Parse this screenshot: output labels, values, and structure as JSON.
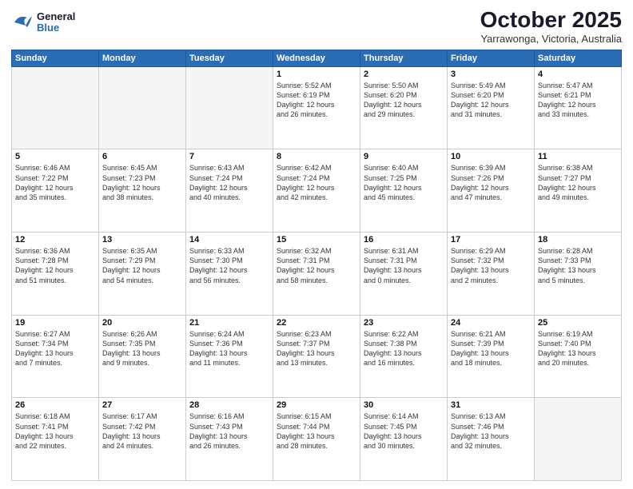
{
  "header": {
    "logo_general": "General",
    "logo_blue": "Blue",
    "title": "October 2025",
    "subtitle": "Yarrawonga, Victoria, Australia"
  },
  "weekdays": [
    "Sunday",
    "Monday",
    "Tuesday",
    "Wednesday",
    "Thursday",
    "Friday",
    "Saturday"
  ],
  "weeks": [
    [
      {
        "day": "",
        "info": ""
      },
      {
        "day": "",
        "info": ""
      },
      {
        "day": "",
        "info": ""
      },
      {
        "day": "1",
        "info": "Sunrise: 5:52 AM\nSunset: 6:19 PM\nDaylight: 12 hours\nand 26 minutes."
      },
      {
        "day": "2",
        "info": "Sunrise: 5:50 AM\nSunset: 6:20 PM\nDaylight: 12 hours\nand 29 minutes."
      },
      {
        "day": "3",
        "info": "Sunrise: 5:49 AM\nSunset: 6:20 PM\nDaylight: 12 hours\nand 31 minutes."
      },
      {
        "day": "4",
        "info": "Sunrise: 5:47 AM\nSunset: 6:21 PM\nDaylight: 12 hours\nand 33 minutes."
      }
    ],
    [
      {
        "day": "5",
        "info": "Sunrise: 6:46 AM\nSunset: 7:22 PM\nDaylight: 12 hours\nand 35 minutes."
      },
      {
        "day": "6",
        "info": "Sunrise: 6:45 AM\nSunset: 7:23 PM\nDaylight: 12 hours\nand 38 minutes."
      },
      {
        "day": "7",
        "info": "Sunrise: 6:43 AM\nSunset: 7:24 PM\nDaylight: 12 hours\nand 40 minutes."
      },
      {
        "day": "8",
        "info": "Sunrise: 6:42 AM\nSunset: 7:24 PM\nDaylight: 12 hours\nand 42 minutes."
      },
      {
        "day": "9",
        "info": "Sunrise: 6:40 AM\nSunset: 7:25 PM\nDaylight: 12 hours\nand 45 minutes."
      },
      {
        "day": "10",
        "info": "Sunrise: 6:39 AM\nSunset: 7:26 PM\nDaylight: 12 hours\nand 47 minutes."
      },
      {
        "day": "11",
        "info": "Sunrise: 6:38 AM\nSunset: 7:27 PM\nDaylight: 12 hours\nand 49 minutes."
      }
    ],
    [
      {
        "day": "12",
        "info": "Sunrise: 6:36 AM\nSunset: 7:28 PM\nDaylight: 12 hours\nand 51 minutes."
      },
      {
        "day": "13",
        "info": "Sunrise: 6:35 AM\nSunset: 7:29 PM\nDaylight: 12 hours\nand 54 minutes."
      },
      {
        "day": "14",
        "info": "Sunrise: 6:33 AM\nSunset: 7:30 PM\nDaylight: 12 hours\nand 56 minutes."
      },
      {
        "day": "15",
        "info": "Sunrise: 6:32 AM\nSunset: 7:31 PM\nDaylight: 12 hours\nand 58 minutes."
      },
      {
        "day": "16",
        "info": "Sunrise: 6:31 AM\nSunset: 7:31 PM\nDaylight: 13 hours\nand 0 minutes."
      },
      {
        "day": "17",
        "info": "Sunrise: 6:29 AM\nSunset: 7:32 PM\nDaylight: 13 hours\nand 2 minutes."
      },
      {
        "day": "18",
        "info": "Sunrise: 6:28 AM\nSunset: 7:33 PM\nDaylight: 13 hours\nand 5 minutes."
      }
    ],
    [
      {
        "day": "19",
        "info": "Sunrise: 6:27 AM\nSunset: 7:34 PM\nDaylight: 13 hours\nand 7 minutes."
      },
      {
        "day": "20",
        "info": "Sunrise: 6:26 AM\nSunset: 7:35 PM\nDaylight: 13 hours\nand 9 minutes."
      },
      {
        "day": "21",
        "info": "Sunrise: 6:24 AM\nSunset: 7:36 PM\nDaylight: 13 hours\nand 11 minutes."
      },
      {
        "day": "22",
        "info": "Sunrise: 6:23 AM\nSunset: 7:37 PM\nDaylight: 13 hours\nand 13 minutes."
      },
      {
        "day": "23",
        "info": "Sunrise: 6:22 AM\nSunset: 7:38 PM\nDaylight: 13 hours\nand 16 minutes."
      },
      {
        "day": "24",
        "info": "Sunrise: 6:21 AM\nSunset: 7:39 PM\nDaylight: 13 hours\nand 18 minutes."
      },
      {
        "day": "25",
        "info": "Sunrise: 6:19 AM\nSunset: 7:40 PM\nDaylight: 13 hours\nand 20 minutes."
      }
    ],
    [
      {
        "day": "26",
        "info": "Sunrise: 6:18 AM\nSunset: 7:41 PM\nDaylight: 13 hours\nand 22 minutes."
      },
      {
        "day": "27",
        "info": "Sunrise: 6:17 AM\nSunset: 7:42 PM\nDaylight: 13 hours\nand 24 minutes."
      },
      {
        "day": "28",
        "info": "Sunrise: 6:16 AM\nSunset: 7:43 PM\nDaylight: 13 hours\nand 26 minutes."
      },
      {
        "day": "29",
        "info": "Sunrise: 6:15 AM\nSunset: 7:44 PM\nDaylight: 13 hours\nand 28 minutes."
      },
      {
        "day": "30",
        "info": "Sunrise: 6:14 AM\nSunset: 7:45 PM\nDaylight: 13 hours\nand 30 minutes."
      },
      {
        "day": "31",
        "info": "Sunrise: 6:13 AM\nSunset: 7:46 PM\nDaylight: 13 hours\nand 32 minutes."
      },
      {
        "day": "",
        "info": ""
      }
    ]
  ]
}
